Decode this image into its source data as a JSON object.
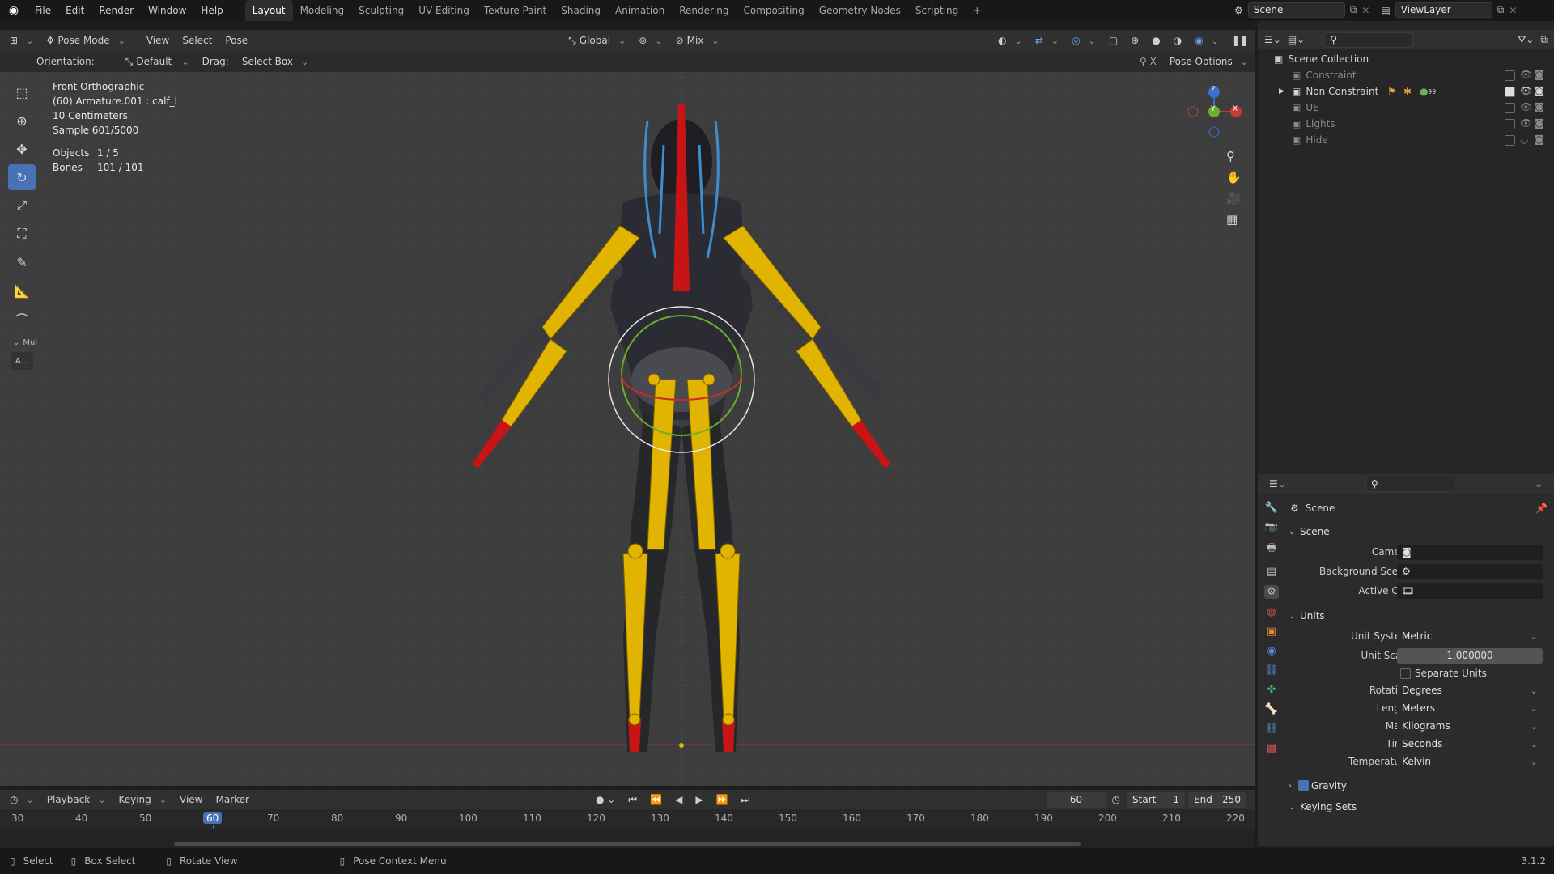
{
  "app_menu": [
    "File",
    "Edit",
    "Render",
    "Window",
    "Help"
  ],
  "workspaces": [
    "Layout",
    "Modeling",
    "Sculpting",
    "UV Editing",
    "Texture Paint",
    "Shading",
    "Animation",
    "Rendering",
    "Compositing",
    "Geometry Nodes",
    "Scripting"
  ],
  "active_workspace": "Layout",
  "top_right": {
    "scene": "Scene",
    "view_layer": "ViewLayer"
  },
  "viewport_header": {
    "mode": "Pose Mode",
    "menus": [
      "View",
      "Select",
      "Pose"
    ],
    "orientation_global": "Global",
    "mix": "Mix"
  },
  "tool_header": {
    "orientation_label": "Orientation:",
    "orientation_value": "Default",
    "drag_label": "Drag:",
    "drag_value": "Select Box",
    "pose_options": "Pose Options"
  },
  "viewport_info": {
    "view": "Front Orthographic",
    "object": "(60) Armature.001 : calf_l",
    "scale": "10 Centimeters",
    "sample": "Sample 601/5000",
    "objects_label": "Objects",
    "objects_value": "1 / 5",
    "bones_label": "Bones",
    "bones_value": "101 / 101"
  },
  "toolbar_extra": {
    "section": "Mul",
    "button": "A..."
  },
  "gizmo": {
    "x": "X",
    "y": "Y",
    "z": "Z"
  },
  "outliner": {
    "root": "Scene Collection",
    "items": [
      {
        "label": "Constraint",
        "visible": false
      },
      {
        "label": "Non Constraint",
        "visible": true,
        "badge": "99"
      },
      {
        "label": "UE",
        "visible": false
      },
      {
        "label": "Lights",
        "visible": false
      },
      {
        "label": "Hide",
        "visible": false
      }
    ]
  },
  "properties": {
    "header": "Scene",
    "scene_section": "Scene",
    "camera_label": "Camera",
    "background_label": "Background Scene",
    "clip_label": "Active Clip",
    "units_section": "Units",
    "unit_system_label": "Unit System",
    "unit_system": "Metric",
    "unit_scale_label": "Unit Scale",
    "unit_scale": "1.000000",
    "separate_units": "Separate Units",
    "rotation_label": "Rotation",
    "rotation": "Degrees",
    "length_label": "Length",
    "length": "Meters",
    "mass_label": "Mass",
    "mass": "Kilograms",
    "time_label": "Time",
    "time": "Seconds",
    "temperature_label": "Temperature",
    "temperature": "Kelvin",
    "gravity": "Gravity",
    "keying_sets": "Keying Sets"
  },
  "timeline": {
    "menus": [
      "Playback",
      "Keying",
      "View",
      "Marker"
    ],
    "current_frame": "60",
    "start_label": "Start",
    "start": "1",
    "end_label": "End",
    "end": "250",
    "ruler": [
      "30",
      "40",
      "50",
      "60",
      "70",
      "80",
      "90",
      "100",
      "110",
      "120",
      "130",
      "140",
      "150",
      "160",
      "170",
      "180",
      "190",
      "200",
      "210",
      "220"
    ]
  },
  "statusbar": {
    "select": "Select",
    "box_select": "Box Select",
    "rotate_view": "Rotate View",
    "pose_context": "Pose Context Menu",
    "version": "3.1.2"
  },
  "colors": {
    "accent": "#4772b3",
    "bone_yellow": "#e0b400",
    "bone_red": "#c81414",
    "bone_blue": "#3a8fd0"
  }
}
